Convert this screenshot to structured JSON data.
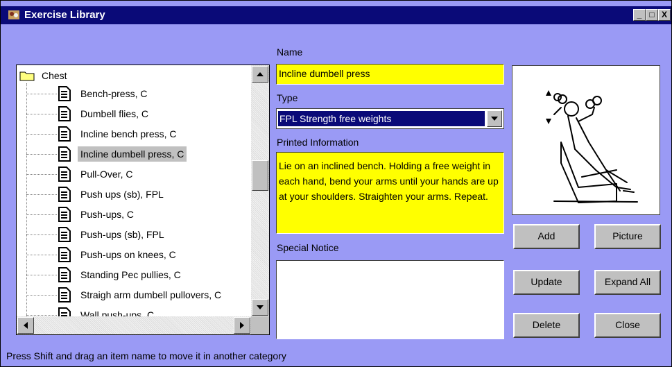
{
  "window": {
    "title": "Exercise Library",
    "controls": {
      "minimize": "_",
      "maximize": "□",
      "close": "X"
    }
  },
  "tree": {
    "root": "Chest",
    "items": [
      "Bench-press, C",
      "Dumbell flies, C",
      "Incline bench press, C",
      "Incline dumbell press, C",
      "Pull-Over, C",
      "Push ups (sb), FPL",
      "Push-ups, C",
      "Push-ups (sb), FPL",
      "Push-ups on knees, C",
      "Standing Pec pullies, C",
      "Straigh arm dumbell pullovers, C",
      "Wall push-ups, C"
    ],
    "selected_index": 3
  },
  "form": {
    "name_label": "Name",
    "name_value": "Incline dumbell press",
    "type_label": "Type",
    "type_value": "FPL  Strength free weights",
    "printed_label": "Printed Information",
    "printed_value": "Lie on an inclined bench. Holding a free weight in each hand, bend your arms until your hands are up at your shoulders. Straighten your arms. Repeat.",
    "notice_label": "Special Notice",
    "notice_value": ""
  },
  "buttons": {
    "add": "Add",
    "picture": "Picture",
    "update": "Update",
    "expand_all": "Expand All",
    "delete": "Delete",
    "close": "Close"
  },
  "status": "Press Shift and drag an item name to move it in another category",
  "colors": {
    "window_bg": "#9a9af5",
    "titlebar": "#0a0a78",
    "field_highlight": "#ffff00",
    "selection": "#0a0a78"
  }
}
